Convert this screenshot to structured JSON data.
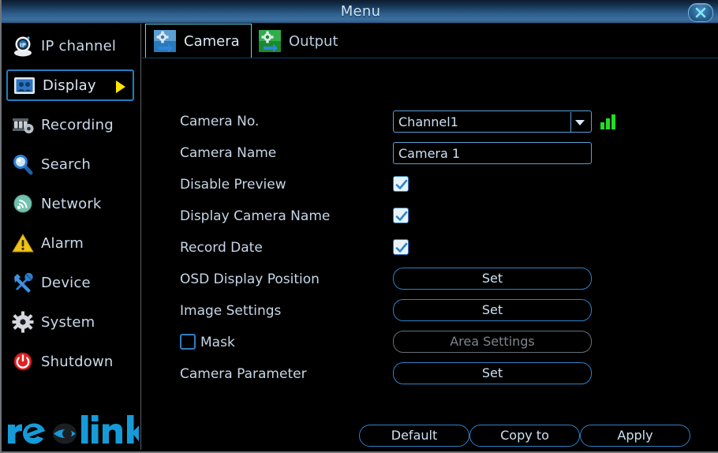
{
  "window": {
    "title": "Menu",
    "close_icon": "close-icon"
  },
  "sidebar": {
    "items": [
      {
        "label": "IP channel",
        "icon": "ip-camera-icon",
        "active": false
      },
      {
        "label": "Display",
        "icon": "display-icon",
        "active": true
      },
      {
        "label": "Recording",
        "icon": "recording-icon",
        "active": false
      },
      {
        "label": "Search",
        "icon": "search-icon",
        "active": false
      },
      {
        "label": "Network",
        "icon": "network-icon",
        "active": false
      },
      {
        "label": "Alarm",
        "icon": "alarm-icon",
        "active": false
      },
      {
        "label": "Device",
        "icon": "device-icon",
        "active": false
      },
      {
        "label": "System",
        "icon": "gear-icon",
        "active": false
      },
      {
        "label": "Shutdown",
        "icon": "power-icon",
        "active": false
      }
    ],
    "logo_text": "reolink"
  },
  "tabs": [
    {
      "label": "Camera",
      "icon": "camera-settings-icon",
      "active": true
    },
    {
      "label": "Output",
      "icon": "output-settings-icon",
      "active": false
    }
  ],
  "form": {
    "camera_no": {
      "label": "Camera No.",
      "value": "Channel1",
      "signal_icon": "signal-strength-icon"
    },
    "camera_name": {
      "label": "Camera Name",
      "value": "Camera 1",
      "placeholder": ""
    },
    "disable_preview": {
      "label": "Disable Preview",
      "checked": true
    },
    "display_camera_name": {
      "label": "Display Camera Name",
      "checked": true
    },
    "record_date": {
      "label": "Record Date",
      "checked": true
    },
    "osd_display_position": {
      "label": "OSD Display Position",
      "button": "Set",
      "disabled": false
    },
    "image_settings": {
      "label": "Image Settings",
      "button": "Set",
      "disabled": false
    },
    "mask": {
      "label": "Mask",
      "checked": false,
      "button": "Area Settings",
      "disabled": true
    },
    "camera_parameter": {
      "label": "Camera Parameter",
      "button": "Set",
      "disabled": false
    }
  },
  "footer": {
    "default_label": "Default",
    "copy_to_label": "Copy to",
    "apply_label": "Apply"
  },
  "colors": {
    "accent_blue": "#2f80c6",
    "active_cyan": "#62d8e8",
    "arrow_yellow": "#ffe500",
    "signal_green": "#22dd22",
    "logo_blue": "#169bd8"
  }
}
